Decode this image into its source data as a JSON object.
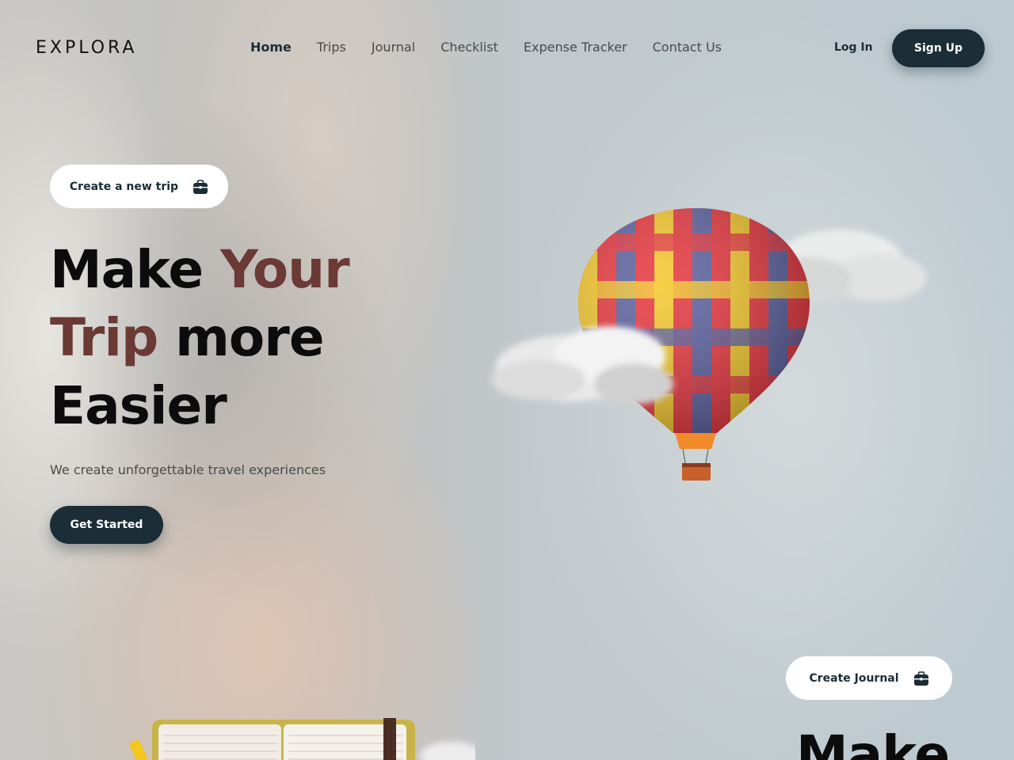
{
  "header": {
    "logo": "EXPLORA",
    "nav": [
      "Home",
      "Trips",
      "Journal",
      "Checklist",
      "Expense Tracker",
      "Contact Us"
    ],
    "active_nav": "Home",
    "login_label": "Log In",
    "signup_label": "Sign Up"
  },
  "hero": {
    "create_trip_label": "Create a new trip",
    "title_part1": "Make ",
    "title_accent1": "Your",
    "title_accent2": "Trip",
    "title_part2": " more",
    "title_part3": "Easier",
    "subtitle": "We create unforgettable travel experiences",
    "cta_label": "Get Started"
  },
  "journal": {
    "create_journal_label": "Create Journal",
    "title_partial": "Make"
  },
  "icons": {
    "pill_icon": "briefcase-icon"
  },
  "colors": {
    "primary": "#1b2d36",
    "accent": "#6b3a34",
    "text": "#0c0c0c",
    "muted": "#4a4a4a"
  }
}
